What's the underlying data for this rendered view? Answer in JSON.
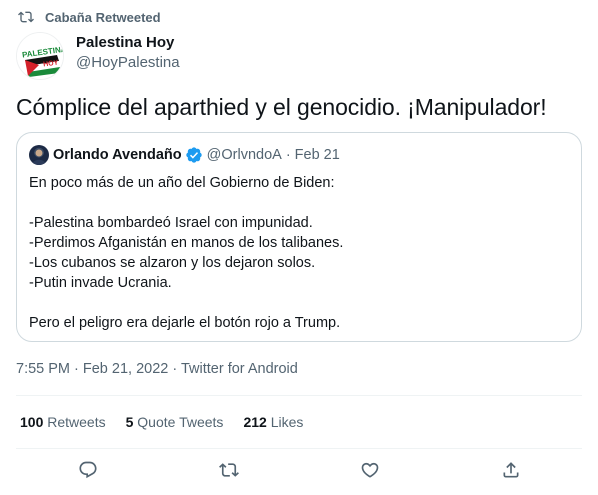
{
  "retweet_context": {
    "text": "Cabaña Retweeted",
    "icon": "retweet-icon"
  },
  "author": {
    "display_name": "Palestina Hoy",
    "handle": "@HoyPalestina",
    "avatar_text_top": "PALESTINA",
    "avatar_text_bottom": "HOY"
  },
  "tweet": {
    "text": "Cómplice del aparthied y el genocidio. ¡Manipulador!"
  },
  "quoted_tweet": {
    "display_name": "Orlando Avendaño",
    "verified": true,
    "handle": "@OrlvndoA",
    "separator": "·",
    "date": "Feb 21",
    "lines": [
      "En poco más de un año del Gobierno de Biden:",
      "",
      "-Palestina bombardeó Israel con impunidad.",
      "-Perdimos Afganistán en manos de los talibanes.",
      "-Los cubanos se alzaron y los dejaron solos.",
      "-Putin invade Ucrania.",
      "",
      "Pero el peligro era dejarle el botón rojo a Trump."
    ]
  },
  "meta": {
    "time": "7:55 PM",
    "separator": " · ",
    "date": "Feb 21, 2022",
    "source": "Twitter for Android"
  },
  "stats": {
    "retweets_count": "100",
    "retweets_label": "Retweets",
    "quote_count": "5",
    "quote_label": "Quote Tweets",
    "likes_count": "212",
    "likes_label": "Likes"
  },
  "actions": {
    "reply_icon": "reply-icon",
    "retweet_icon": "retweet-icon",
    "like_icon": "heart-icon",
    "share_icon": "share-icon"
  },
  "colors": {
    "text_primary": "#0f1419",
    "text_secondary": "#536471",
    "border": "#cfd9de",
    "divider": "#eff3f4",
    "verified": "#1d9bf0"
  }
}
